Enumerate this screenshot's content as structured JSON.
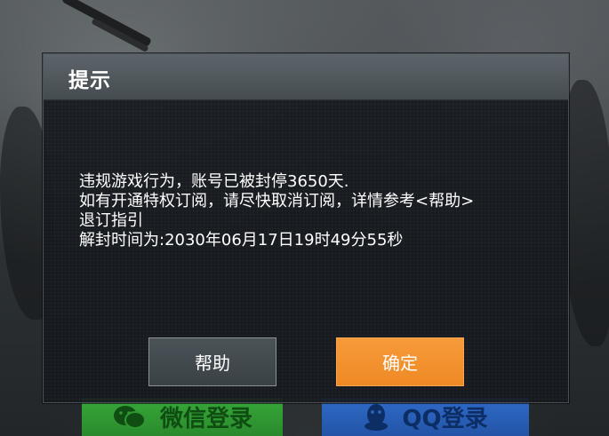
{
  "dialog": {
    "title": "提示",
    "lines": [
      "违规游戏行为，账号已被封停3650天.",
      "如有开通特权订阅，请尽快取消订阅，详情参考<帮助>",
      "退订指引",
      "解封时间为:2030年06月17日19时49分55秒"
    ],
    "help_label": "帮助",
    "confirm_label": "确定"
  },
  "background": {
    "wechat_login_label": "微信登录",
    "qq_login_label": "QQ登录",
    "wechat_color": "#2f9a33",
    "qq_color": "#2a60b8"
  },
  "colors": {
    "confirm_accent": "#f39230",
    "dialog_bg": "#15191d",
    "header_bg": "#50575c"
  }
}
